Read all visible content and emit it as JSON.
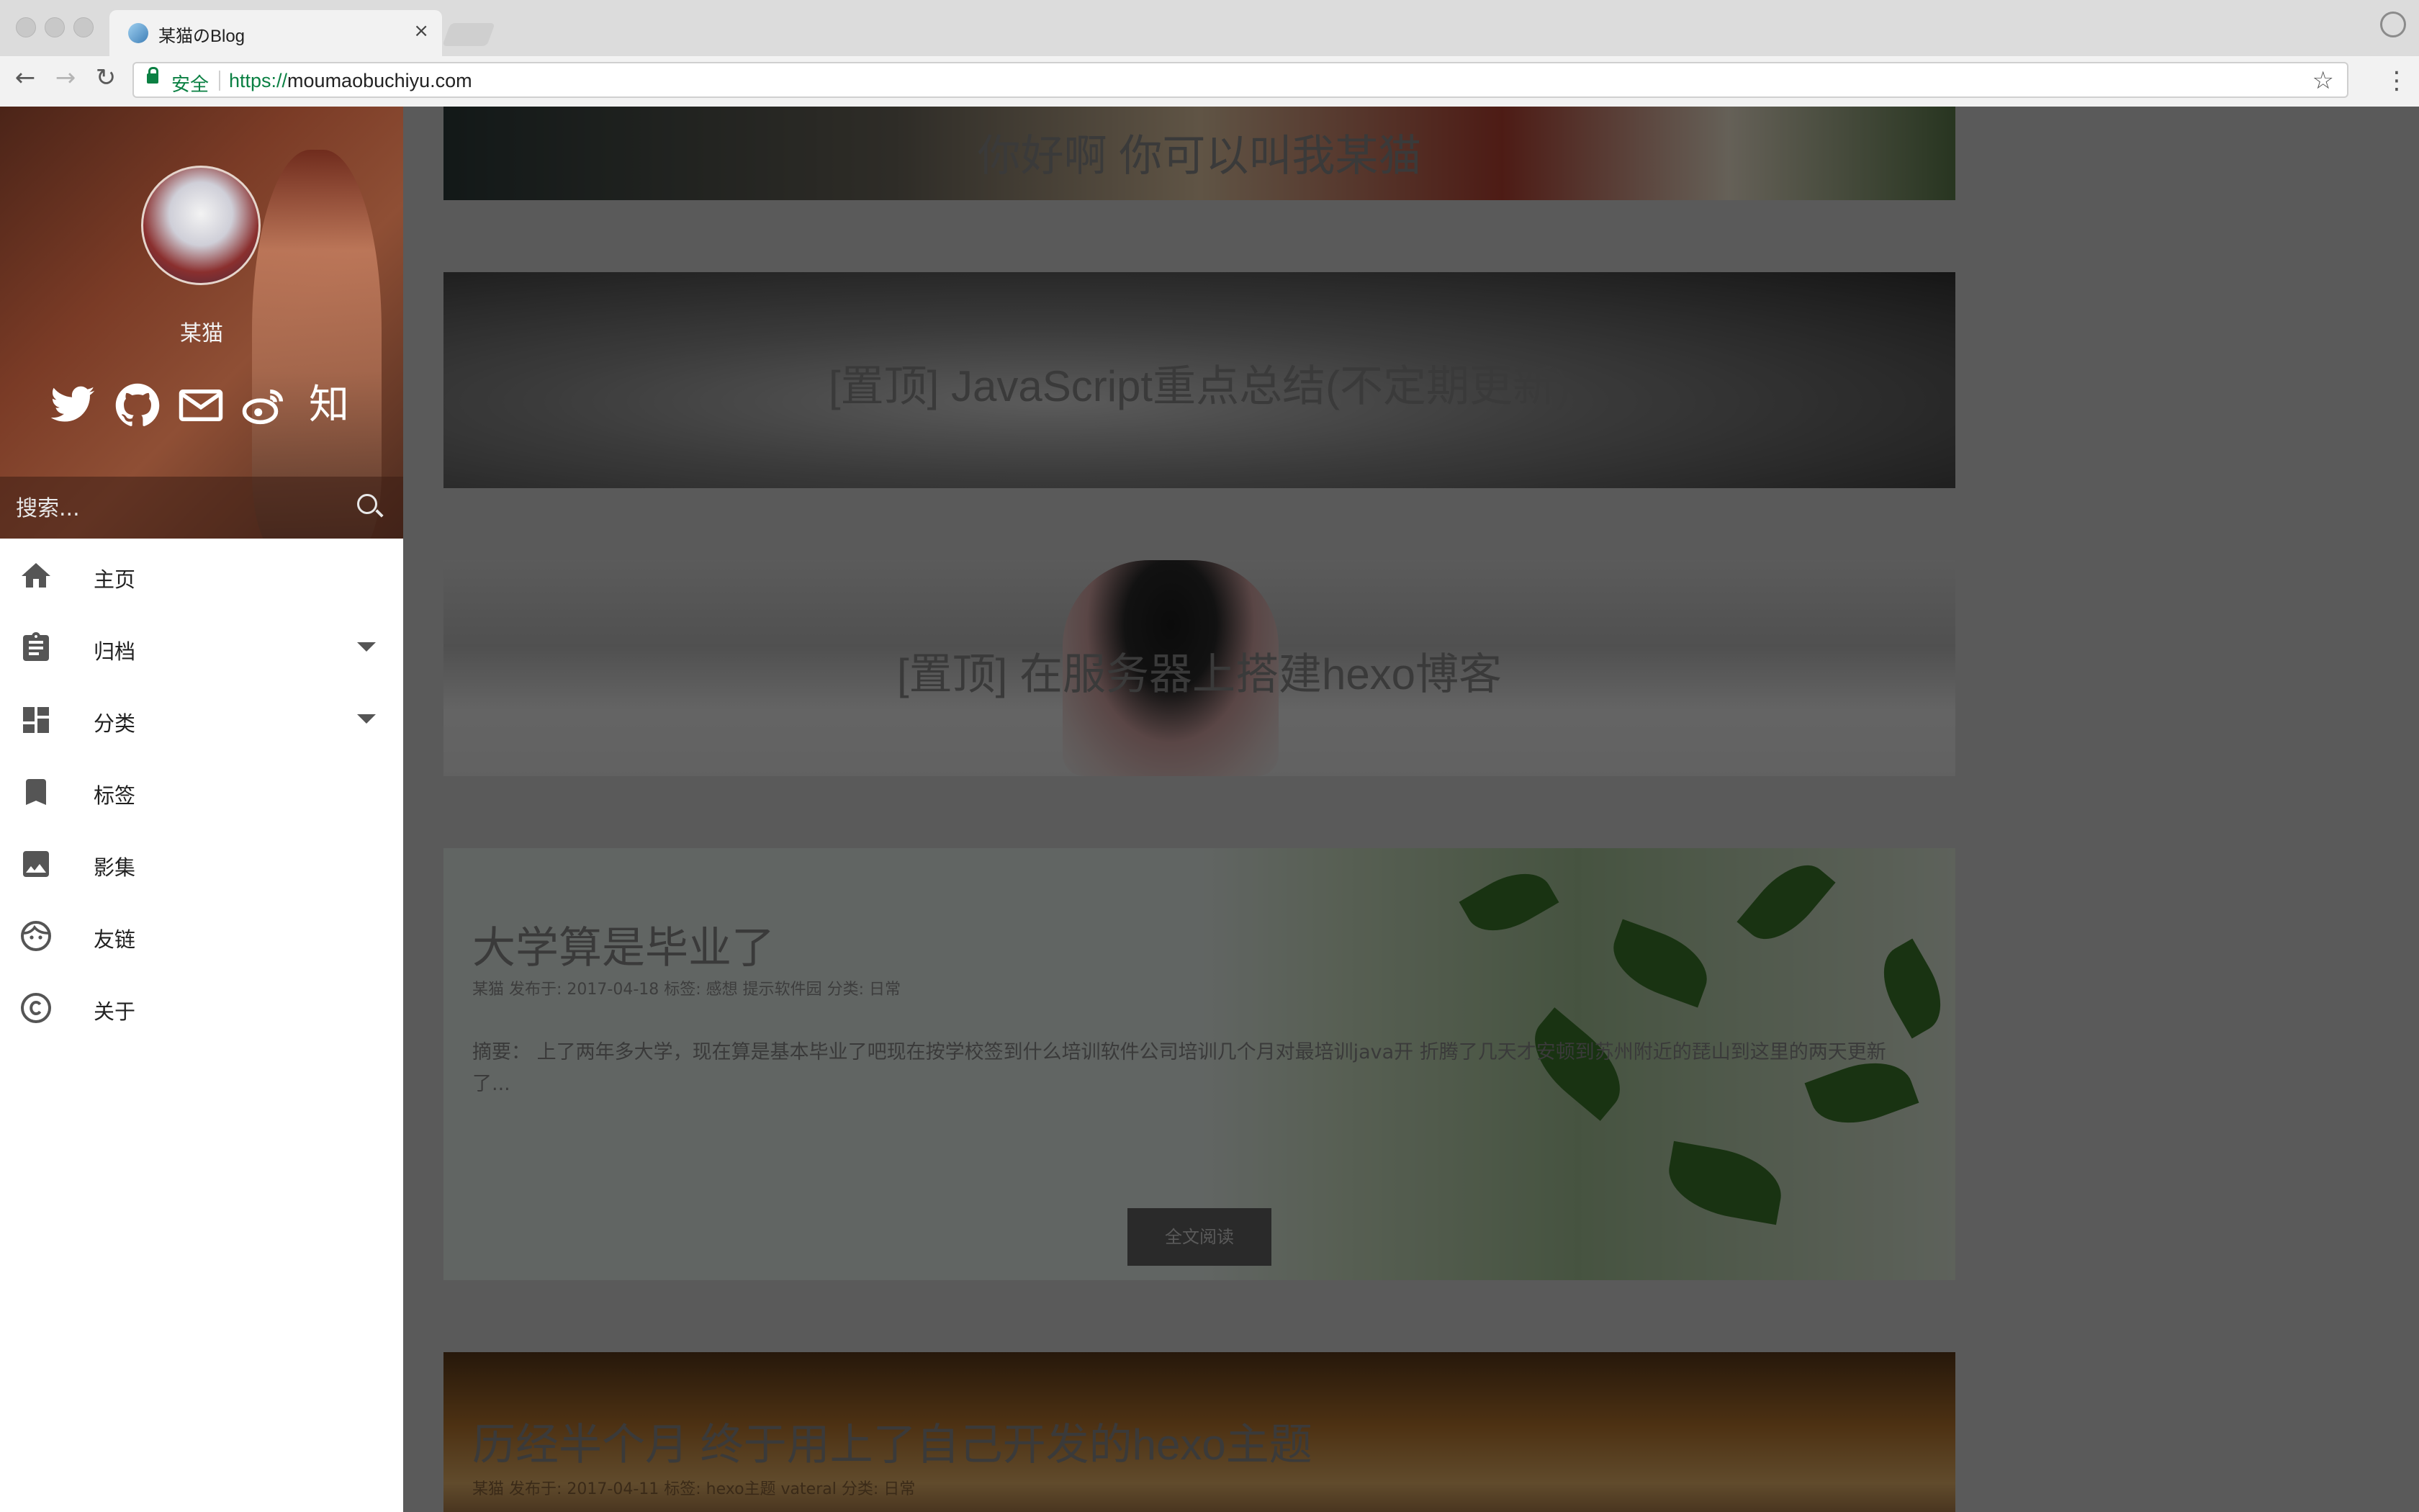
{
  "browser": {
    "tab_title": "某猫のBlog",
    "tab_close": "×",
    "secure_label": "安全",
    "url_scheme": "https://",
    "url_host": "moumaobuchiyu.com",
    "back": "←",
    "forward": "→",
    "reload": "↻",
    "star": "☆",
    "menu": "⋮"
  },
  "sidebar": {
    "username": "某猫",
    "search_placeholder": "搜索...",
    "social": [
      {
        "icon": "twitter-icon"
      },
      {
        "icon": "github-icon"
      },
      {
        "icon": "mail-icon"
      },
      {
        "icon": "weibo-icon"
      },
      {
        "icon": "zhihu-icon",
        "text": "知"
      }
    ],
    "menu": [
      {
        "label": "主页",
        "icon": "home-icon"
      },
      {
        "label": "归档",
        "icon": "clipboard-icon",
        "expandable": true
      },
      {
        "label": "分类",
        "icon": "dashboard-icon",
        "expandable": true
      },
      {
        "label": "标签",
        "icon": "bookmark-icon"
      },
      {
        "label": "影集",
        "icon": "image-icon"
      },
      {
        "label": "友链",
        "icon": "face-icon"
      },
      {
        "label": "关于",
        "icon": "copyright-icon"
      }
    ]
  },
  "posts": [
    {
      "title": "你好啊 你可以叫我某猫"
    },
    {
      "title": "[置顶] JavaScript重点总结(不定期更新)"
    },
    {
      "title": "[置顶] 在服务器上搭建hexo博客"
    },
    {
      "title": "大学算是毕业了",
      "meta": "某猫 发布于: 2017-04-18 标签: 感想 提示软件园 分类: 日常",
      "excerpt": "摘要：  上了两年多大学，现在算是基本毕业了吧现在按学校签到什么培训软件公司培训几个月对最培训java开      折腾了几天才安顿到苏州附近的琵山到这里的两天更新了...",
      "read_more": "全文阅读"
    },
    {
      "title": "历经半个月 终于用上了自己开发的hexo主题",
      "meta": "某猫 发布于: 2017-04-11 标签: hexo主题 vateral 分类: 日常"
    }
  ],
  "colors": {
    "overlay": "#000000",
    "secure_green": "#0b8043",
    "sidebar_bg": "#ffffff"
  }
}
